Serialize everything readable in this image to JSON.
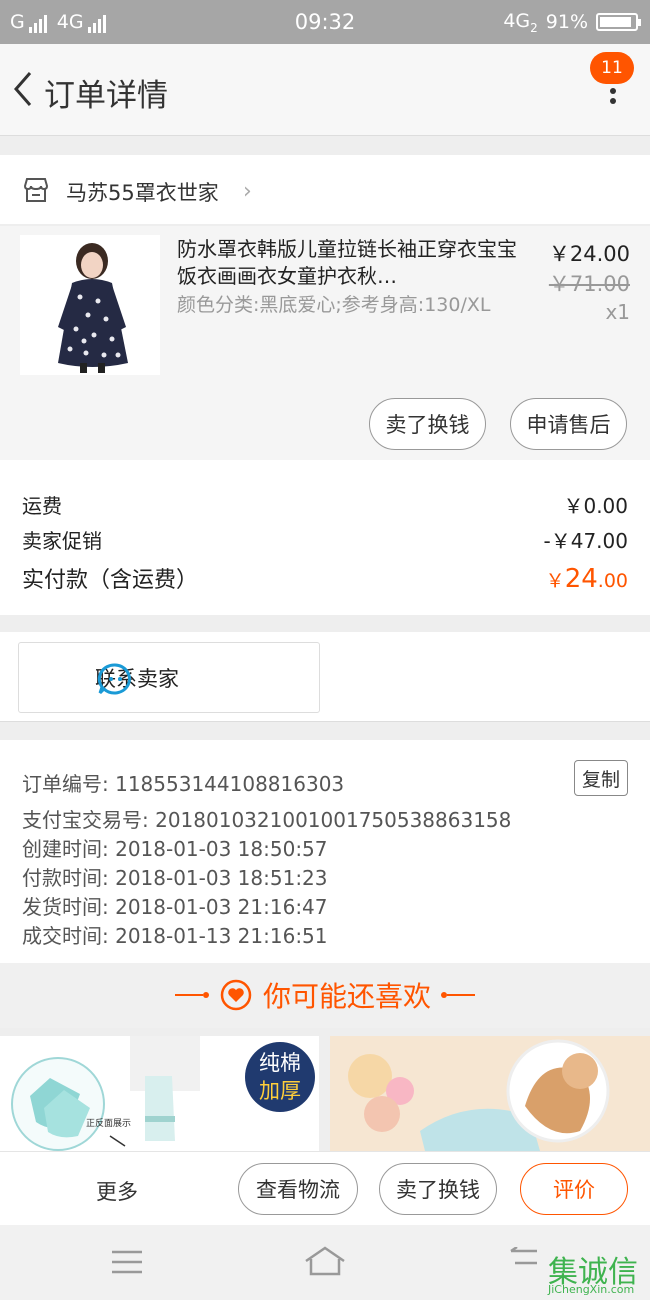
{
  "status_bar": {
    "carrier_1": "G",
    "carrier_2": "4G",
    "time": "09:32",
    "network": "4G",
    "network_sub": "2",
    "battery": "91%",
    "battery_level": 0.91
  },
  "header": {
    "title": "订单详情",
    "notification_count": "11"
  },
  "shop": {
    "name": "马苏55罩衣世家"
  },
  "item": {
    "title": "防水罩衣韩版儿童拉链长袖正穿衣宝宝饭衣画画衣女童护衣秋…",
    "sku": "颜色分类:黑底爱心;参考身高:130/XL",
    "price": "￥24.00",
    "original_price": "￥71.00",
    "quantity": "x1",
    "buttons": {
      "sell_for_cash": "卖了换钱",
      "after_sale": "申请售后"
    }
  },
  "fees": {
    "shipping_label": "运费",
    "shipping_value": "￥0.00",
    "promo_label": "卖家促销",
    "promo_value": "-￥47.00",
    "total_label": "实付款（含运费）",
    "total_currency": "￥",
    "total_integer": "24",
    "total_decimal": ".00"
  },
  "contact": {
    "label": "联系卖家"
  },
  "order_info": {
    "order_no": "订单编号: 118553144108816303",
    "copy_label": "复制",
    "alipay_no": "支付宝交易号: 2018010321001001750538863158",
    "created": "创建时间: 2018-01-03 18:50:57",
    "paid": "付款时间: 2018-01-03 18:51:23",
    "shipped": "发货时间: 2018-01-03 21:16:47",
    "completed": "成交时间: 2018-01-13 21:16:51"
  },
  "recommend": {
    "title": "你可能还喜欢",
    "card1_badge_line1": "纯棉",
    "card1_badge_line2": "加厚",
    "card1_caption": "正反面展示"
  },
  "actions": {
    "more": "更多",
    "logistics": "查看物流",
    "sell_for_cash": "卖了换钱",
    "review": "评价"
  },
  "watermark": {
    "text": "集诚信",
    "url": "JiChengXin.com"
  },
  "colors": {
    "accent": "#ff5500",
    "status_bar": "#a6a6a6"
  }
}
